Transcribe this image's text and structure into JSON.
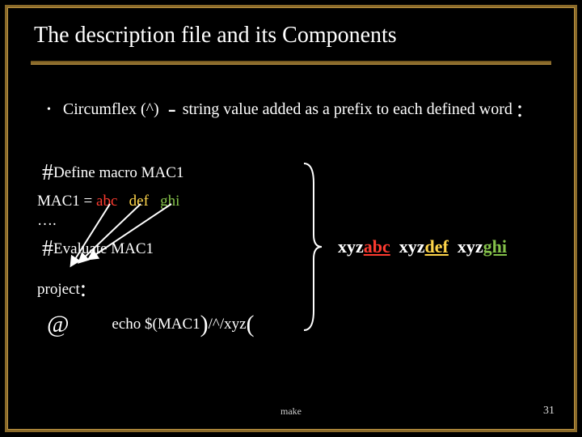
{
  "title": "The description file and its Components",
  "bullet": {
    "label": "Circumflex (^)",
    "dash": "-",
    "desc": "string value added as a prefix to each defined word",
    "colon": ":"
  },
  "code": {
    "define": "Define macro MAC1",
    "mac_lhs": "MAC1 =  ",
    "abc": "abc",
    "def": "def",
    "ghi": "ghi",
    "dots": "….",
    "evaluate": "Evaluate MAC1",
    "project": "project",
    "at": "@",
    "echo_pre": "echo $(MAC1",
    "echo_mid": "/^/xyz",
    "paren": "("
  },
  "result": {
    "xyz1": "xyz",
    "abc": "abc",
    "xyz2": "xyz",
    "def": "def",
    "xyz3": "xyz",
    "ghi": "ghi"
  },
  "footer": {
    "center": "make",
    "page": "31"
  }
}
